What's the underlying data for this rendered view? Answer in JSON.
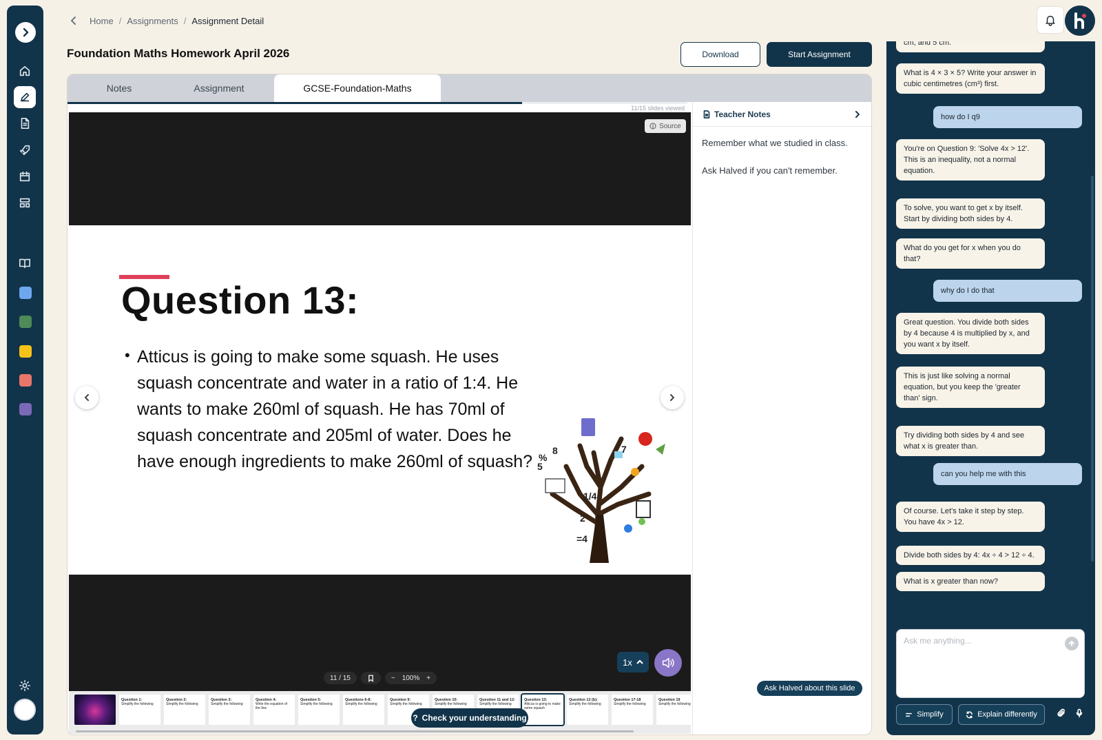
{
  "breadcrumb": {
    "home": "Home",
    "assignments": "Assignments",
    "current": "Assignment Detail",
    "separator": "/"
  },
  "page": {
    "title": "Foundation Maths Homework April 2026"
  },
  "actions": {
    "download": "Download",
    "start": "Start Assignment"
  },
  "tabs": [
    {
      "label": "Notes",
      "active": false
    },
    {
      "label": "Assignment",
      "active": false
    },
    {
      "label": "GCSE-Foundation-Maths",
      "active": true
    }
  ],
  "viewer": {
    "slides_viewed": "11/15 slides viewed",
    "progress_fraction": 0.733,
    "source_label": "Source",
    "slide_title": "Question 13:",
    "slide_text": "Atticus is going to make some squash. He uses squash concentrate and water in a ratio of 1:4. He wants to make 260ml of squash. He has 70ml of squash concentrate and 205ml of water. Does he have enough ingredients to make 260ml of squash?",
    "page_indicator": "11 / 15",
    "zoom": "100%",
    "zoom_out": "−",
    "zoom_in": "+",
    "playback_speed": "1x",
    "check_understanding": "Check your understanding"
  },
  "thumbnails": [
    {
      "title": "",
      "line": ""
    },
    {
      "title": "Question 1:",
      "line": "Simplify the following"
    },
    {
      "title": "Question 2:",
      "line": "Simplify the following"
    },
    {
      "title": "Question 3:",
      "line": "Simplify the following"
    },
    {
      "title": "Question 4:",
      "line": "Write the equation of the line"
    },
    {
      "title": "Question 5:",
      "line": "Simplify the following"
    },
    {
      "title": "Questions 6-8:",
      "line": "Simplify the following"
    },
    {
      "title": "Question 9:",
      "line": "Simplify the following"
    },
    {
      "title": "Question 10:",
      "line": "Simplify the following"
    },
    {
      "title": "Question 11 and 12:",
      "line": "Simplify the following"
    },
    {
      "title": "Question 13:",
      "line": "Atticus is going to make some squash"
    },
    {
      "title": "Question 13 (b):",
      "line": "Simplify the following"
    },
    {
      "title": "Question 17-18",
      "line": "Simplify the following"
    },
    {
      "title": "Question 19",
      "line": "Simplify the following"
    }
  ],
  "notes": {
    "title": "Teacher Notes",
    "lines": [
      "Remember what we studied in class.",
      "Ask Halved if you can't remember."
    ],
    "ask_about_slide": "Ask Halved about this slide"
  },
  "chat": {
    "messages": [
      {
        "role": "ai",
        "text": "cm, and 5 cm."
      },
      {
        "role": "ai",
        "text": "What is 4 × 3 × 5? Write your answer in cubic centimetres (cm³) first."
      },
      {
        "role": "user",
        "text": "how do I q9"
      },
      {
        "role": "ai",
        "text": "You're on Question 9: 'Solve 4x > 12'. This is an inequality, not a normal equation."
      },
      {
        "role": "ai",
        "text": "To solve, you want to get x by itself. Start by dividing both sides by 4."
      },
      {
        "role": "ai",
        "text": "What do you get for x when you do that?"
      },
      {
        "role": "user",
        "text": "why do I do that"
      },
      {
        "role": "ai",
        "text": "Great question. You divide both sides by 4 because 4 is multiplied by x, and you want x by itself."
      },
      {
        "role": "ai",
        "text": "This is just like solving a normal equation, but you keep the 'greater than' sign."
      },
      {
        "role": "ai",
        "text": "Try dividing both sides by 4 and see what x is greater than."
      },
      {
        "role": "user",
        "text": "can you help me with this"
      },
      {
        "role": "ai",
        "text": "Of course. Let's take it step by step. You have 4x > 12."
      },
      {
        "role": "ai",
        "text": "Divide both sides by 4: 4x ÷ 4 > 12 ÷ 4."
      },
      {
        "role": "ai",
        "text": "What is x greater than now?"
      }
    ],
    "input_placeholder": "Ask me anything...",
    "simplify": "Simplify",
    "explain_differently": "Explain differently"
  },
  "colors": {
    "brand": "#12344a",
    "accent": "#e0415a",
    "audio": "#8976c7",
    "user_bubble": "#bcd5ec",
    "ai_bubble": "#f8f3e8"
  },
  "sidebar": {
    "icons": [
      "home-icon",
      "edit-icon",
      "document-icon",
      "rocket-icon",
      "calendar-icon",
      "layout-icon",
      "book-icon",
      "settings-icon"
    ],
    "folder_colors": [
      "#6da7ef",
      "#4f8a58",
      "#f5c21a",
      "#e8776a",
      "#7b69b8"
    ]
  }
}
